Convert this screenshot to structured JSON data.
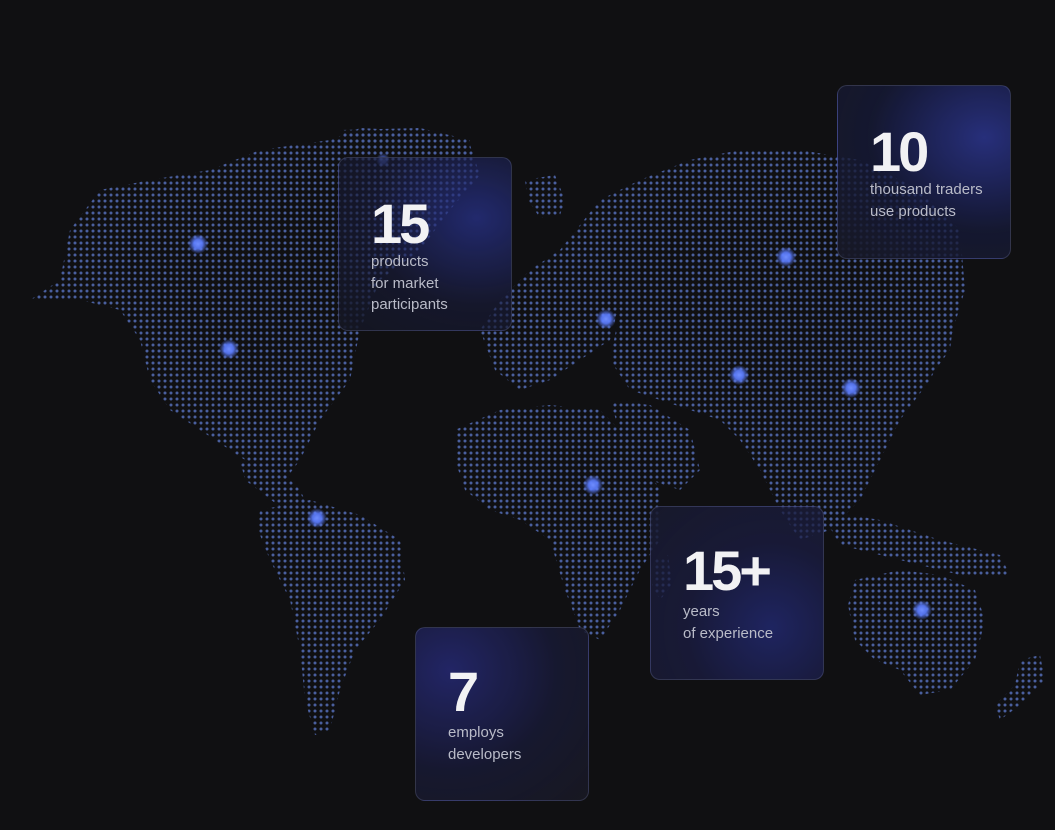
{
  "colors": {
    "background": "#101012",
    "map_dot": "#4a5f9e",
    "marker": "#5b7cff",
    "number": "#f2f2f4",
    "label": "#b9bbc8"
  },
  "map": {
    "markers": 11
  },
  "stats": [
    {
      "value": "15",
      "label": "products\nfor market\nparticipants"
    },
    {
      "value": "10",
      "label": "thousand traders\nuse products"
    },
    {
      "value": "15+",
      "label": "years\nof experience"
    },
    {
      "value": "7",
      "label": "employs\ndevelopers"
    }
  ]
}
